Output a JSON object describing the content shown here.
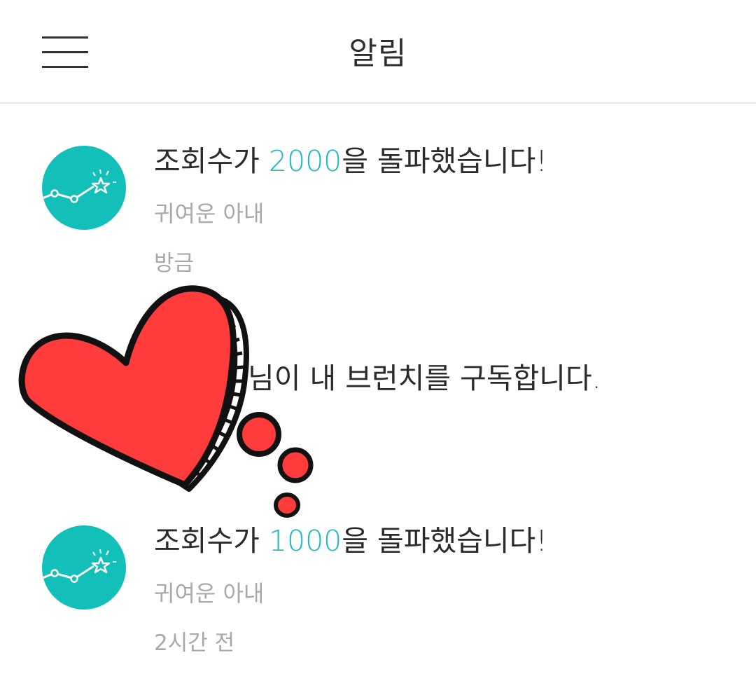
{
  "header": {
    "title": "알림",
    "menu_icon": "hamburger-menu-icon"
  },
  "notifications": [
    {
      "icon": "stats-star-icon",
      "title_prefix": "조회수가 ",
      "title_highlight": "2000",
      "title_suffix": "을 돌파했습니다!",
      "subtitle": "귀여운 아내",
      "time": "방금"
    },
    {
      "icon": "",
      "title_prefix": "",
      "title_highlight": "",
      "title_suffix": "님이 내 브런치를 구독합니다.",
      "subtitle": "",
      "time": ""
    },
    {
      "icon": "stats-star-icon",
      "title_prefix": "조회수가 ",
      "title_highlight": "1000",
      "title_suffix": "을 돌파했습니다!",
      "subtitle": "귀여운 아내",
      "time": "2시간 전"
    }
  ],
  "sticker": {
    "icon": "heart-sticker-icon"
  },
  "colors": {
    "accent": "#1eb8c0",
    "avatar_bg": "#12bfb9",
    "heart": "#ff3b3b",
    "muted_text": "#a9a9a9"
  }
}
